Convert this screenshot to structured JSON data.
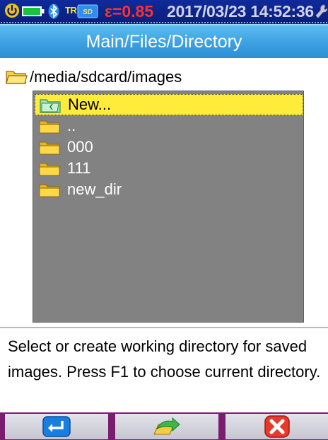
{
  "status_bar": {
    "tr_label": "TR",
    "emissivity": "ε=0.85",
    "datetime": "2017/03/23 14:52:36",
    "icons": [
      "power-icon",
      "battery-icon",
      "bluetooth-icon",
      "tr-sd-icon",
      "wrench-icon"
    ]
  },
  "title": "Main/Files/Directory",
  "path": "/media/sdcard/images",
  "files": [
    {
      "label": "New...",
      "icon": "new-folder-icon",
      "selected": true
    },
    {
      "label": "..",
      "icon": "folder-icon",
      "selected": false
    },
    {
      "label": "000",
      "icon": "folder-icon",
      "selected": false
    },
    {
      "label": "111",
      "icon": "folder-icon",
      "selected": false
    },
    {
      "label": "new_dir",
      "icon": "folder-icon",
      "selected": false
    }
  ],
  "help_text": "Select or create working directory for saved images. Press F1 to choose current directory.",
  "function_keys": [
    {
      "icon": "enter-icon"
    },
    {
      "icon": "move-arrow-icon"
    },
    {
      "icon": "cancel-icon"
    }
  ],
  "colors": {
    "status_bg": "#0a1f7a",
    "title_bg": "#3a9ee0",
    "list_bg": "#828282",
    "selection": "#ffeb3a",
    "fkey_frame": "#7a1d6f"
  }
}
